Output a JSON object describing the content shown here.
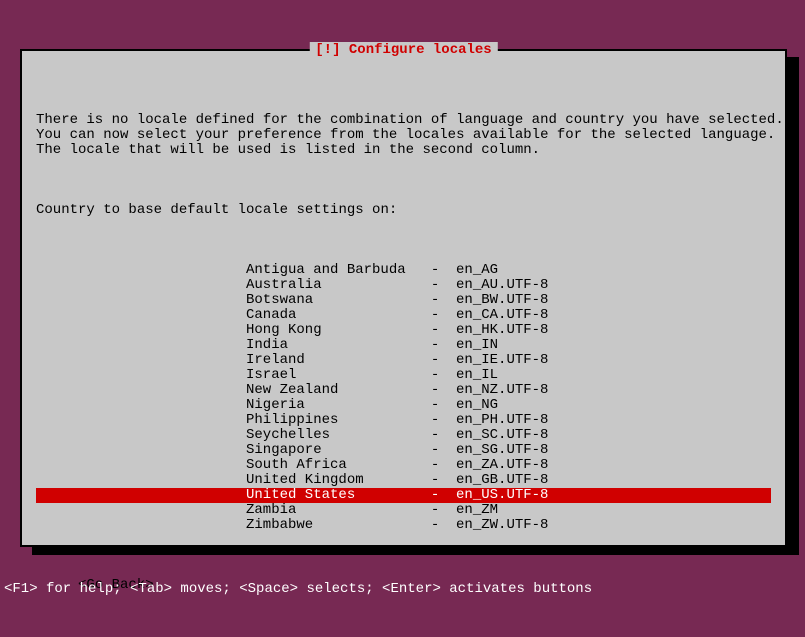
{
  "dialog": {
    "title": "[!] Configure locales",
    "description_line1": "There is no locale defined for the combination of language and country you have selected.",
    "description_line2": "You can now select your preference from the locales available for the selected language.",
    "description_line3": "The locale that will be used is listed in the second column.",
    "prompt": "Country to base default locale settings on:",
    "go_back": "<Go Back>"
  },
  "locales": [
    {
      "country": "Antigua and Barbuda",
      "locale": "en_AG",
      "selected": false
    },
    {
      "country": "Australia",
      "locale": "en_AU.UTF-8",
      "selected": false
    },
    {
      "country": "Botswana",
      "locale": "en_BW.UTF-8",
      "selected": false
    },
    {
      "country": "Canada",
      "locale": "en_CA.UTF-8",
      "selected": false
    },
    {
      "country": "Hong Kong",
      "locale": "en_HK.UTF-8",
      "selected": false
    },
    {
      "country": "India",
      "locale": "en_IN",
      "selected": false
    },
    {
      "country": "Ireland",
      "locale": "en_IE.UTF-8",
      "selected": false
    },
    {
      "country": "Israel",
      "locale": "en_IL",
      "selected": false
    },
    {
      "country": "New Zealand",
      "locale": "en_NZ.UTF-8",
      "selected": false
    },
    {
      "country": "Nigeria",
      "locale": "en_NG",
      "selected": false
    },
    {
      "country": "Philippines",
      "locale": "en_PH.UTF-8",
      "selected": false
    },
    {
      "country": "Seychelles",
      "locale": "en_SC.UTF-8",
      "selected": false
    },
    {
      "country": "Singapore",
      "locale": "en_SG.UTF-8",
      "selected": false
    },
    {
      "country": "South Africa",
      "locale": "en_ZA.UTF-8",
      "selected": false
    },
    {
      "country": "United Kingdom",
      "locale": "en_GB.UTF-8",
      "selected": false
    },
    {
      "country": "United States",
      "locale": "en_US.UTF-8",
      "selected": true
    },
    {
      "country": "Zambia",
      "locale": "en_ZM",
      "selected": false
    },
    {
      "country": "Zimbabwe",
      "locale": "en_ZW.UTF-8",
      "selected": false
    }
  ],
  "status_bar": "<F1> for help; <Tab> moves; <Space> selects; <Enter> activates buttons"
}
